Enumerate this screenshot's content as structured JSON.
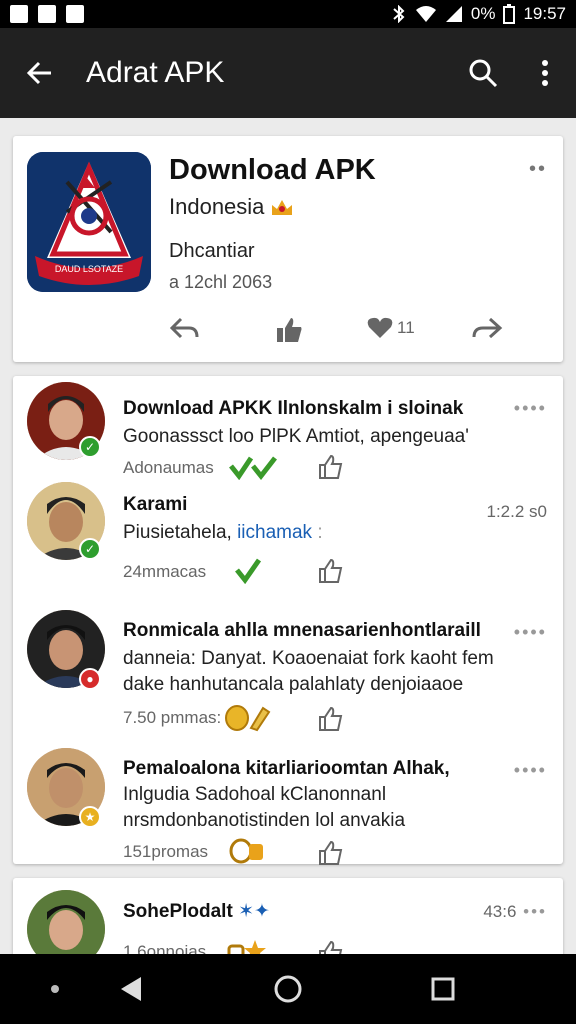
{
  "status_bar": {
    "battery": "0%",
    "time": "19:57"
  },
  "app_bar": {
    "title": "Adrat APK"
  },
  "app_card": {
    "name": "Download APK",
    "country": "Indonesia",
    "developer": "Dhcantiar",
    "date": "a 12chl 2063",
    "heart_count": "11"
  },
  "comments": [
    {
      "name": "Download APKK Ilnlonskalm i sloinak",
      "lines": [
        "Goonasssct loo PlPK Amtiot, apengeuaa'"
      ],
      "time": "Adonaumas",
      "stamp": "",
      "badge_color": "#2e9e2e"
    },
    {
      "name": "Karami",
      "lines": [
        "Piusietahela, ",
        "iichamak"
      ],
      "time": "24mmacas",
      "stamp": "1:2.2 s0",
      "badge_color": "#2e9e2e"
    },
    {
      "name": "Ronmicala ahlla mnenasarienhontlaraill",
      "lines": [
        "danneia: Danyat. Koaoenaiat fork kaoht   fem",
        "dake hanhutancala palahlaty denjoiaaoe"
      ],
      "time": "7.50 pmmas:",
      "stamp": "",
      "badge_color": "#d62b2b"
    },
    {
      "name": "Pemaloalona kitarliarioomtan Alhak,",
      "lines": [
        "Inlgudia Sadohoal kClanonnanl",
        "nrsmdonbanotistinden lol anvakia"
      ],
      "time": "151promas",
      "stamp": "",
      "badge_color": "#e8b020"
    },
    {
      "name": "SohePlodalt",
      "lines": [],
      "time": "1.6onnoias",
      "stamp": "43:6",
      "badge_color": ""
    }
  ]
}
